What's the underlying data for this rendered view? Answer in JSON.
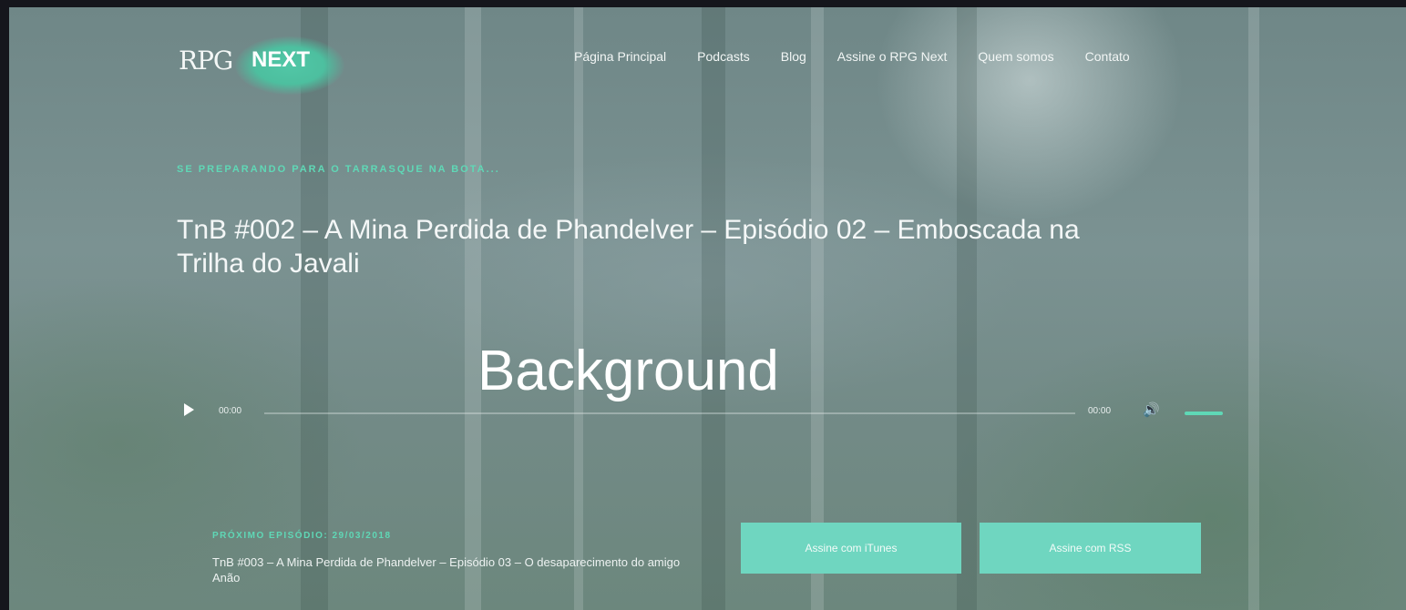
{
  "brand": {
    "rpg": "RPG",
    "next": "NEXT"
  },
  "nav": [
    {
      "label": "Página Principal"
    },
    {
      "label": "Podcasts"
    },
    {
      "label": "Blog"
    },
    {
      "label": "Assine o RPG Next"
    },
    {
      "label": "Quem somos"
    },
    {
      "label": "Contato"
    }
  ],
  "hero": {
    "kicker": "Se preparando para o Tarrasque na bota...",
    "title": "TnB #002 – A Mina Perdida de Phandelver – Episódio 02 – Emboscada na Trilha do Javali"
  },
  "overlay": {
    "label": "Background"
  },
  "player": {
    "current_time": "00:00",
    "duration": "00:00",
    "volume_level": 1.0
  },
  "next_episode": {
    "kicker": "Próximo episódio: 29/03/2018",
    "title": "TnB #003 – A Mina Perdida de Phandelver – Episódio 03 – O desaparecimento do amigo Anão"
  },
  "buttons": {
    "itunes": "Assine com iTunes",
    "rss": "Assine com RSS"
  },
  "colors": {
    "accent": "#5fd8b6",
    "button": "#6fd6c0",
    "page_bg": "#15161c"
  },
  "icons": {
    "play": "play-icon",
    "volume": "volume-icon"
  }
}
